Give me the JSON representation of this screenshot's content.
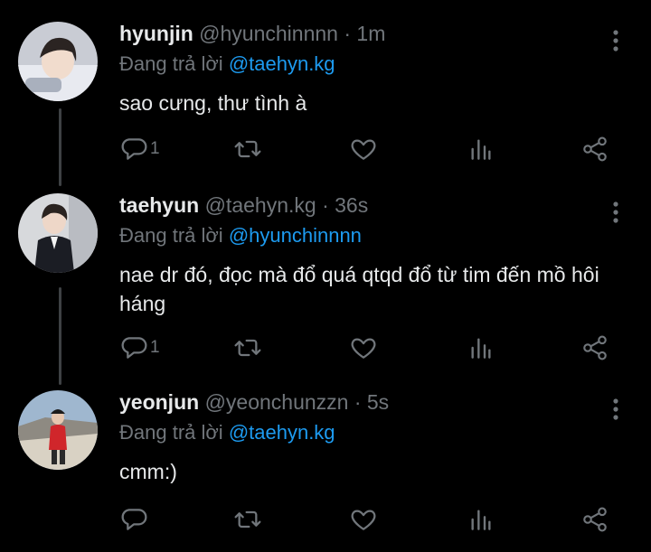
{
  "tweets": [
    {
      "name": "hyunjin",
      "handle": "@hyunchinnnn",
      "time": "· 1m",
      "reply_prefix": "Đang trả lời ",
      "reply_to": "@taehyn.kg",
      "text": "sao cưng, thư tình à",
      "reply_count": "1"
    },
    {
      "name": "taehyun",
      "handle": "@taehyn.kg",
      "time": "· 36s",
      "reply_prefix": "Đang trả lời ",
      "reply_to": "@hyunchinnnn",
      "text": "nae dr đó, đọc mà đổ quá qtqd đổ từ tim đến mồ hôi háng",
      "reply_count": "1"
    },
    {
      "name": "yeonjun",
      "handle": "@yeonchunzzn",
      "time": "· 5s",
      "reply_prefix": "Đang trả lời ",
      "reply_to": "@taehyn.kg",
      "text": "cmm:)",
      "reply_count": ""
    }
  ],
  "icons": {
    "reply": "speech-bubble-icon",
    "retweet": "retweet-icon",
    "like": "heart-icon",
    "views": "bar-chart-icon",
    "share": "share-icon",
    "more": "vertical-dots-icon"
  },
  "colors": {
    "background": "#000000",
    "text": "#e7e9ea",
    "muted": "#71767b",
    "mention": "#1d9bf0",
    "thread_line": "#3e4144"
  }
}
